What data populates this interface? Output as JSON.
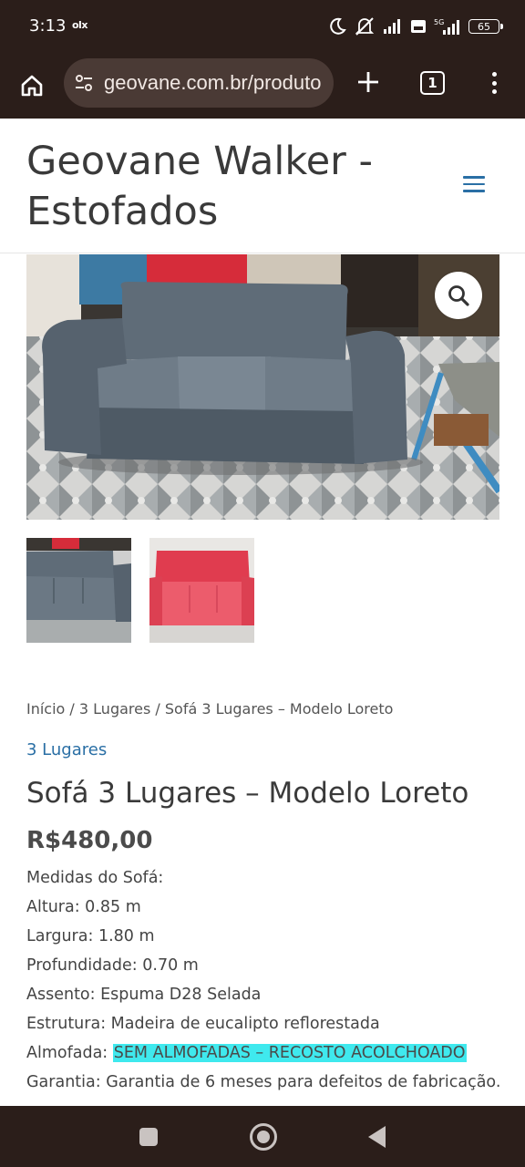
{
  "status_bar": {
    "time": "3:13",
    "app_icon": "olx",
    "battery": "65",
    "icons": [
      "moon-icon",
      "mute-icon",
      "signal-icon",
      "volte-icon",
      "5g-signal-icon",
      "battery-icon"
    ]
  },
  "browser": {
    "url": "geovane.com.br/produto",
    "tab_count": "1",
    "icons": [
      "home-icon",
      "site-settings-icon",
      "new-tab-icon",
      "tab-switcher-icon",
      "overflow-menu-icon"
    ]
  },
  "site": {
    "title": "Geovane Walker - Estofados",
    "menu_icon": "hamburger-menu-icon",
    "accent_color": "#2a6fa5"
  },
  "gallery": {
    "main_image": "gray-sofa-photo",
    "zoom_icon": "magnifier-icon",
    "thumbnails": [
      "gray-sofa-thumbnail",
      "red-sofa-thumbnail"
    ]
  },
  "product": {
    "breadcrumb": [
      "Início",
      "3 Lugares",
      "Sofá 3 Lugares – Modelo Loreto"
    ],
    "breadcrumb_separator": " / ",
    "category": "3 Lugares",
    "title": "Sofá 3 Lugares – Modelo Loreto",
    "price": "R$480,00",
    "description": [
      "Medidas do Sofá:",
      "Altura: 0.85 m",
      "Largura: 1.80 m",
      "Profundidade: 0.70 m",
      "Assento: Espuma D28 Selada",
      "Estrutura: Madeira de eucalipto reflorestada"
    ],
    "cushion_label": "Almofada: ",
    "cushion_value": "SEM ALMOFADAS – RECOSTO ACOLCHOADO",
    "highlight_color": "#3fe9ee",
    "warranty": "Garantia: Garantia de 6 meses para defeitos de fabricação."
  },
  "nav_bar": {
    "icons": [
      "recent-apps-icon",
      "home-circle-icon",
      "back-icon"
    ]
  }
}
